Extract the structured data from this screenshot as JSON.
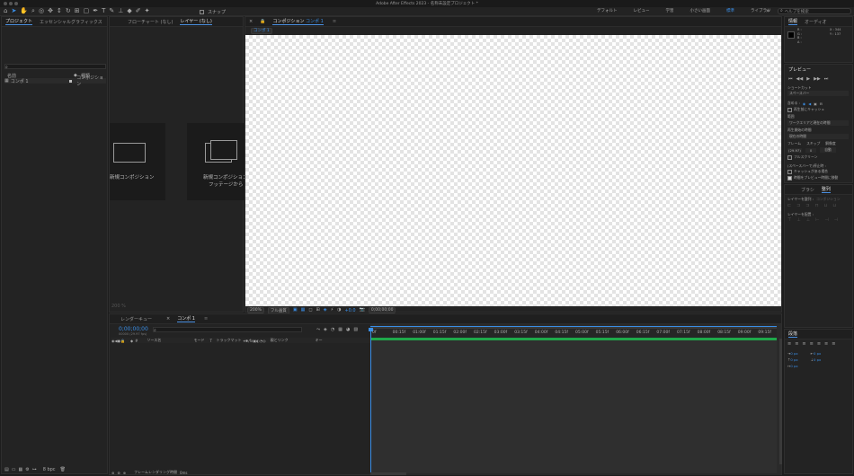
{
  "window": {
    "title": "Adobe After Effects 2023 - 名称未設定プロジェクト *"
  },
  "toolbar": {
    "snap_label": "スナップ",
    "workspaces": [
      "デフォルト",
      "レビュー",
      "学習",
      "小さい画面",
      "標準",
      "ライブラリ"
    ],
    "active_workspace": "標準",
    "help_search_placeholder": "ヘルプを検索"
  },
  "project_panel": {
    "tabs": [
      "プロジェクト",
      "エッセンシャルグラフィックス"
    ],
    "active_tab": "プロジェクト",
    "columns": {
      "name": "名前",
      "type": "種類"
    },
    "items": [
      {
        "name": "コンポ 1",
        "type": "コンポジション"
      }
    ],
    "bpc": "8 bpc"
  },
  "flowchart_tab": "フローチャート (なし)",
  "layer_tab": "レイヤー (なし)",
  "new_comp": {
    "card1": "新規コンポジション",
    "card2_line1": "新規コンポジション",
    "card2_line2": "フッテージから"
  },
  "comp_panel": {
    "tab_label": "コンポジション",
    "comp_name": "コンポ 1",
    "breadcrumb": "コンポ 1",
    "zoom": "200%",
    "quality": "フル画質",
    "timecode": "0;00;00;00",
    "exposure": "+0.0"
  },
  "layer_footer": {
    "zoom": "200 %"
  },
  "info_panel": {
    "tabs": [
      "情報",
      "オーディオ"
    ],
    "rgb": [
      "R :",
      "G :",
      "B :",
      "A :"
    ],
    "x_label": "X : 344",
    "y_label": "Y : 137"
  },
  "preview_panel": {
    "title": "プレビュー",
    "shortcut_label": "ショートカット",
    "shortcut_value": "スペースバー",
    "include_label": "含める :",
    "cache_label": "再生前にキャッシュ",
    "range_label": "範囲",
    "range_value": "ワークエリアと現在の時間",
    "play_from_label": "再生開始の時間",
    "play_from_value": "現在の時間",
    "frame_rate_label": "フレーム",
    "skip_label": "スキップ",
    "resolution_label": "解像度",
    "frame_rate_value": "(29.97)",
    "skip_value": "0",
    "resolution_value": "自動",
    "fullscreen_label": "フルスクリーン",
    "spacebar_stop_label": "(スペースバーで)停止時 :",
    "cache_if_label": "キャッシュがある場合",
    "move_time_label": "時間をプレビュー時間に移動"
  },
  "align_panel": {
    "tabs": [
      "ブラシ",
      "整列"
    ],
    "active_tab": "整列",
    "align_label": "レイヤーを整列 :",
    "align_target": "コンポジション",
    "distribute_label": "レイヤーを配置 :"
  },
  "character_panel": {
    "title": "段落",
    "values": [
      "0 px",
      "0 px",
      "0 px",
      "0 px",
      "0 px"
    ]
  },
  "timeline": {
    "tabs": [
      "レンダーキュー",
      "コンポ 1"
    ],
    "active_tab": "コンポ 1",
    "timecode": "0;00;00;00",
    "timecode_sub": "00000 (29.97 fps)",
    "search_placeholder": "",
    "columns": {
      "source": "ソース名",
      "mode": "モード",
      "t": "T",
      "trackmatte": "トラックマット",
      "parent": "親とリンク",
      "keys": "キー"
    },
    "ruler": [
      "0f",
      "00:15f",
      "01:00f",
      "01:15f",
      "02:00f",
      "02:15f",
      "03:00f",
      "03:15f",
      "04:00f",
      "04:15f",
      "05:00f",
      "05:15f",
      "06:00f",
      "06:15f",
      "07:00f",
      "07:15f",
      "08:00f",
      "08:15f",
      "09:00f",
      "09:15f"
    ],
    "footer": "フレームレンダリング時間",
    "footer_value": "0ms"
  },
  "colors": {
    "accent": "#3a8ee6",
    "workarea": "#1fa84a",
    "playhead": "#3a8ee6"
  }
}
